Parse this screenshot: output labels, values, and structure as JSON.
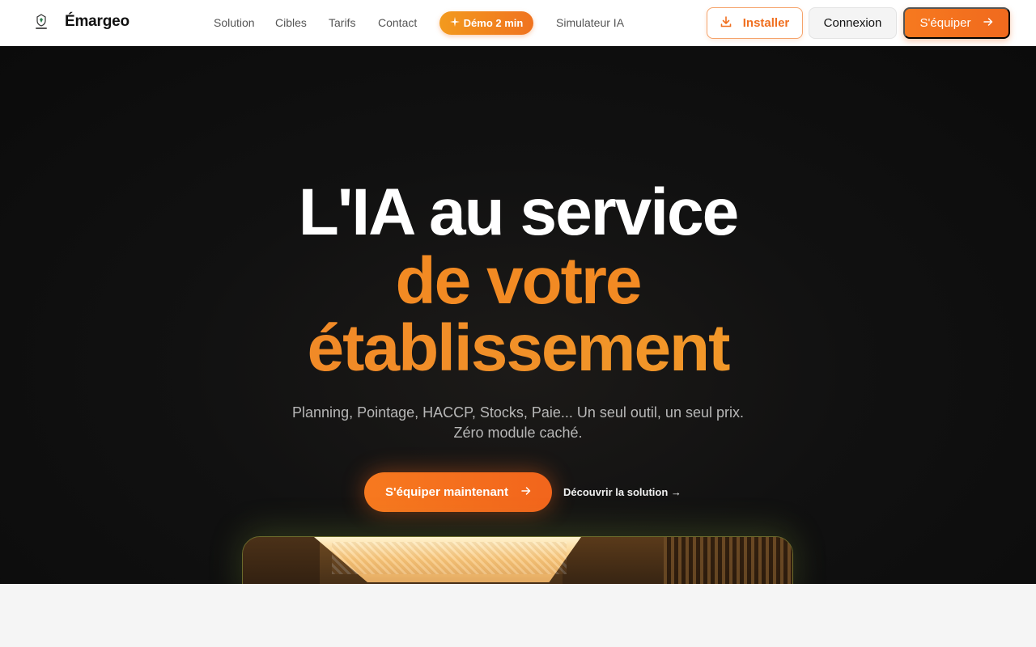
{
  "brand": {
    "name": "Émargeo",
    "logo_text": "Émargeo",
    "logo_icon": "shield-sparkle-icon"
  },
  "nav": {
    "links": [
      "Solution",
      "Cibles",
      "Tarifs",
      "Contact"
    ],
    "demo_label": "Démo 2 min",
    "demo_icon": "sparkle-icon",
    "simulator_label": "Simulateur IA"
  },
  "actions": {
    "install_label": "Installer",
    "install_icon": "download-icon",
    "login_label": "Connexion",
    "equip_label": "S'équiper",
    "equip_icon": "arrow-right-icon"
  },
  "hero": {
    "line1": "L'IA au service",
    "line2": "de votre",
    "line3": "établissement",
    "subtitle_1": "Planning, Pointage, HACCP, Stocks, Paie... Un seul outil, un seul prix.",
    "subtitle_2": "Zéro module caché.",
    "cta_primary": "S'équiper maintenant",
    "cta_secondary": "Découvrir la solution →"
  },
  "colors": {
    "accent": "#f2781f",
    "accent_light": "#f2a22a",
    "hero_bg": "#0f0f0f",
    "page_bg": "#f5f5f5"
  }
}
